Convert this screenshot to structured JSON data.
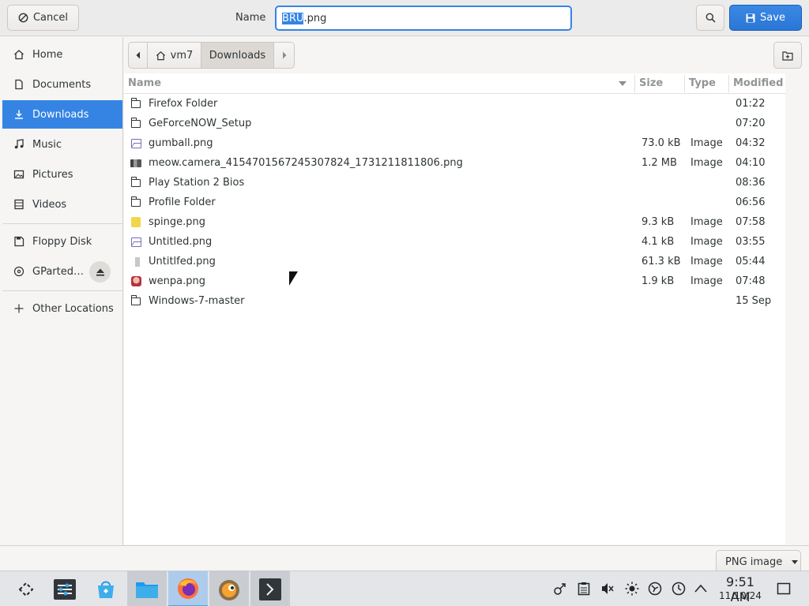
{
  "header": {
    "cancel_label": "Cancel",
    "name_label": "Name",
    "filename_selected": "BRU",
    "filename_rest": ".png",
    "save_label": "Save"
  },
  "sidebar": {
    "items": [
      {
        "label": "Home",
        "icon": "home-icon"
      },
      {
        "label": "Documents",
        "icon": "documents-icon"
      },
      {
        "label": "Downloads",
        "icon": "downloads-icon",
        "active": true
      },
      {
        "label": "Music",
        "icon": "music-icon"
      },
      {
        "label": "Pictures",
        "icon": "pictures-icon"
      },
      {
        "label": "Videos",
        "icon": "videos-icon"
      },
      {
        "label": "Floppy Disk",
        "icon": "floppy-disk-icon"
      },
      {
        "label": "GParted…",
        "icon": "disc-icon"
      },
      {
        "label": "Other Locations",
        "icon": "plus-icon"
      }
    ]
  },
  "pathbar": {
    "segments": [
      "vm7",
      "Downloads"
    ]
  },
  "columns": {
    "name": "Name",
    "size": "Size",
    "type": "Type",
    "modified": "Modified"
  },
  "files": [
    {
      "name": "Firefox Folder",
      "size": "",
      "type": "",
      "modified": "01:22",
      "icon": "folder-icon"
    },
    {
      "name": "GeForceNOW_Setup",
      "size": "",
      "type": "",
      "modified": "07:20",
      "icon": "folder-icon"
    },
    {
      "name": "gumball.png",
      "size": "73.0 kB",
      "type": "Image",
      "modified": "04:32",
      "icon": "image-icon"
    },
    {
      "name": "meow.camera_4154701567245307824_1731211811806.png",
      "size": "1.2 MB",
      "type": "Image",
      "modified": "04:10",
      "icon": "image-thumbnail-icon"
    },
    {
      "name": "Play Station 2 Bios",
      "size": "",
      "type": "",
      "modified": "08:36",
      "icon": "folder-icon"
    },
    {
      "name": "Profile Folder",
      "size": "",
      "type": "",
      "modified": "06:56",
      "icon": "folder-icon"
    },
    {
      "name": "spinge.png",
      "size": "9.3 kB",
      "type": "Image",
      "modified": "07:58",
      "icon": "sponge-thumbnail-icon"
    },
    {
      "name": "Untitled.png",
      "size": "4.1 kB",
      "type": "Image",
      "modified": "03:55",
      "icon": "image-icon"
    },
    {
      "name": "Untitlfed.png",
      "size": "61.3 kB",
      "type": "Image",
      "modified": "05:44",
      "icon": "image-thumbnail-icon"
    },
    {
      "name": "wenpa.png",
      "size": "1.9 kB",
      "type": "Image",
      "modified": "07:48",
      "icon": "wenpa-thumbnail-icon"
    },
    {
      "name": "Windows-7-master",
      "size": "",
      "type": "",
      "modified": "15 Sep",
      "icon": "folder-icon"
    }
  ],
  "filter": {
    "selected": "PNG image"
  },
  "taskbar": {
    "apps": [
      "app-launcher-icon",
      "system-settings-icon",
      "discover-icon",
      "file-manager-icon",
      "firefox-icon",
      "gimp-icon",
      "terminal-icon"
    ],
    "clock_time": "9:51 AM",
    "clock_date": "11/10/24"
  },
  "colors": {
    "accent": "#3584e4",
    "sidebar_active": "#3584e4"
  }
}
